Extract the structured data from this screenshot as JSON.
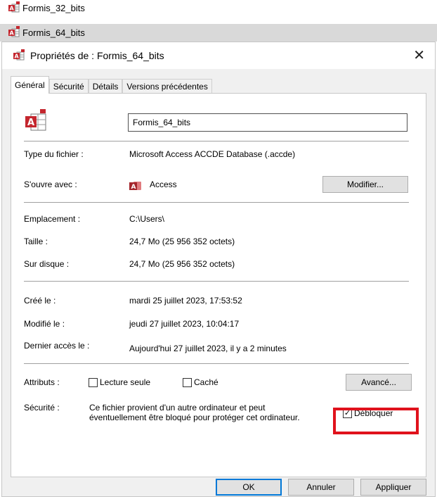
{
  "explorer": {
    "files": [
      {
        "name": "Formis_32_bits",
        "icon": "access-db-icon"
      },
      {
        "name": "Formis_64_bits",
        "icon": "access-db-icon"
      }
    ]
  },
  "dialog": {
    "title": "Propriétés de : Formis_64_bits",
    "tabs": [
      "Général",
      "Sécurité",
      "Détails",
      "Versions précédentes"
    ],
    "file_name": "Formis_64_bits",
    "rows": {
      "type_label": "Type du fichier :",
      "type_value": "Microsoft Access ACCDE Database (.accde)",
      "opens_label": "S'ouvre avec :",
      "opens_value": "Access",
      "change_button": "Modifier...",
      "location_label": "Emplacement :",
      "location_value": "C:\\Users\\",
      "size_label": "Taille :",
      "size_value": "24,7 Mo (25 956 352 octets)",
      "disk_label": "Sur disque :",
      "disk_value": "24,7 Mo (25 956 352 octets)",
      "created_label": "Créé le :",
      "created_value": "mardi 25 juillet 2023, 17:53:52",
      "modified_label": "Modifié le :",
      "modified_value": "jeudi 27 juillet 2023, 10:04:17",
      "accessed_label": "Dernier accès le :",
      "accessed_value": "Aujourd'hui 27 juillet 2023, il y a 2 minutes"
    },
    "attributes": {
      "label": "Attributs :",
      "readonly_label": "Lecture seule",
      "readonly_checked": false,
      "hidden_label": "Caché",
      "hidden_checked": false,
      "advanced_button": "Avancé..."
    },
    "security": {
      "label": "Sécurité :",
      "text_line1": "Ce fichier provient d'un autre ordinateur et peut",
      "text_line2": "éventuellement être bloqué pour protéger cet ordinateur.",
      "unblock_label": "Débloquer",
      "unblock_checked": true,
      "highlight_color": "#e0121c"
    },
    "buttons": {
      "ok": "OK",
      "cancel": "Annuler",
      "apply": "Appliquer"
    },
    "close_glyph": "✕",
    "check_glyph": "✓"
  }
}
